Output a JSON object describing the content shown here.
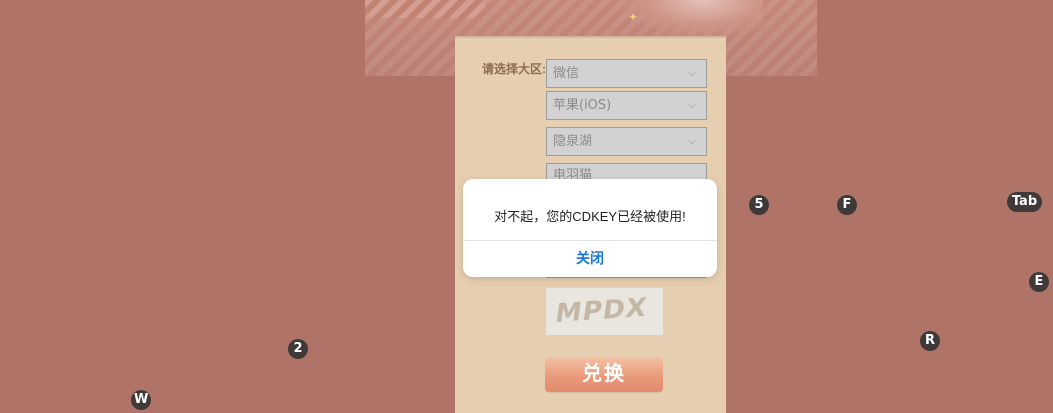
{
  "region": {
    "label": "请选择大区:",
    "selects": [
      {
        "value": "微信"
      },
      {
        "value": "苹果(iOS)"
      },
      {
        "value": "隐泉湖"
      },
      {
        "value": "电羽猫"
      }
    ]
  },
  "captcha": {
    "text": "MPDX"
  },
  "redeem_button": {
    "label": "兑换"
  },
  "dialog": {
    "message": "对不起，您的CDKEY已经被使用!",
    "close_label": "关闭"
  },
  "key_hints": [
    {
      "label": "5"
    },
    {
      "label": "F"
    },
    {
      "label": "Tab"
    },
    {
      "label": "E"
    },
    {
      "label": "R"
    },
    {
      "label": "2"
    },
    {
      "label": "W"
    }
  ],
  "colors": {
    "page_bg": "#b07368",
    "panel_bg": "#e6cfb0",
    "dialog_accent": "#1677d8"
  },
  "icons": {
    "chevron": "chevron-down-icon"
  }
}
